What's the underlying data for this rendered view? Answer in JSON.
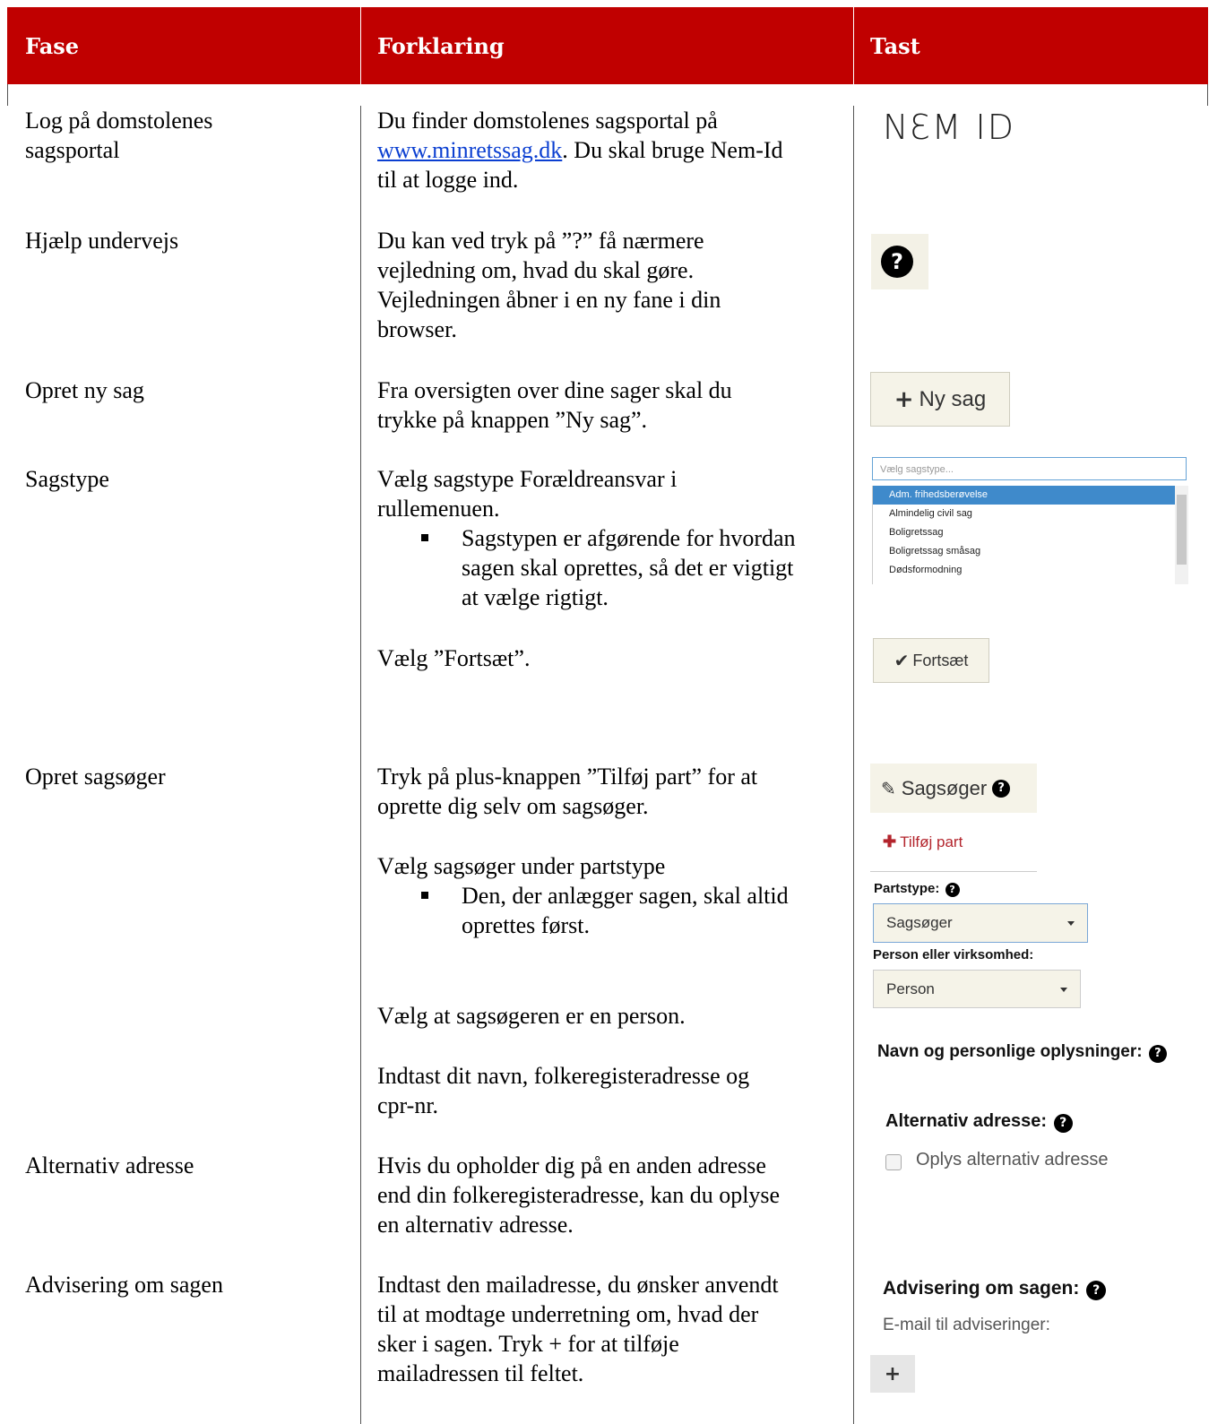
{
  "header": {
    "col1": "Fase",
    "col2": "Forklaring",
    "col3": "Tast"
  },
  "rows": {
    "login": {
      "fase_line1": "Log på domstolenes",
      "fase_line2": "sagsportal",
      "text_line1": "Du finder domstolenes sagsportal på",
      "link": "www.minretssag.dk",
      "text_line2_rest": ". Du skal bruge Nem-Id",
      "text_line3": "til at logge ind.",
      "nemid": "NƐM ID"
    },
    "help": {
      "fase": "Hjælp undervejs",
      "lines": [
        "Du kan ved tryk på ”?” få nærmere",
        "vejledning om, hvad du skal gøre.",
        "Vejledningen åbner i en ny fane i din",
        "browser."
      ],
      "icon": "question-circle-icon"
    },
    "new_case": {
      "fase": "Opret ny sag",
      "lines": [
        "Fra oversigten over dine sager skal du",
        "trykke på knappen ”Ny sag”."
      ],
      "button": "Ny sag"
    },
    "case_type": {
      "fase": "Sagstype",
      "lines": [
        "Vælg sagstype Forældreansvar i",
        "rullemenuen."
      ],
      "bullet_lines": [
        "Sagstypen er afgørende for hvordan",
        "sagen skal oprettes, så det er vigtigt",
        "at vælge rigtigt."
      ],
      "select_placeholder": "Vælg sagstype...",
      "options": [
        "Adm. frihedsberøvelse",
        "Almindelig civil sag",
        "Boligretssag",
        "Boligretssag småsag",
        "Dødsformodning"
      ],
      "continue_text": "Vælg ”Fortsæt”.",
      "continue_button": "Fortsæt"
    },
    "plaintiff": {
      "fase": "Opret sagsøger",
      "lines1": [
        "Tryk på plus-knappen ”Tilføj part” for at",
        "oprette dig selv om sagsøger."
      ],
      "line2": "Vælg sagsøger under partstype",
      "bullet_lines": [
        "Den, der anlægger sagen, skal altid",
        "oprettes først."
      ],
      "line3": "Vælg at sagsøgeren er en person.",
      "lines4": [
        "Indtast dit navn, folkeregisteradresse og",
        "cpr-nr."
      ],
      "panel_title": "Sagsøger",
      "add_party": "Tilføj part",
      "party_type_label": "Partstype:",
      "party_type_value": "Sagsøger",
      "person_label": "Person eller virksomhed:",
      "person_value": "Person",
      "personal_info_title": "Navn og personlige oplysninger:"
    },
    "alt_address": {
      "fase": "Alternativ adresse",
      "lines": [
        "Hvis du opholder dig på en anden adresse",
        "end din folkeregisteradresse, kan du oplyse",
        "en alternativ adresse."
      ],
      "title": "Alternativ adresse:",
      "checkbox_label": "Oplys alternativ adresse"
    },
    "notify": {
      "fase": "Advisering om sagen",
      "lines": [
        "Indtast den mailadresse, du ønsker anvendt",
        "til at modtage underretning om, hvad der",
        "sker i sagen. Tryk + for at tilføje",
        "mailadressen til feltet."
      ],
      "title": "Advisering om sagen:",
      "email_label": "E-mail til adviseringer:",
      "plus": "+"
    }
  },
  "colors": {
    "header_bg": "#c00000",
    "link": "#0b3fd1",
    "select_active": "#3f8acb",
    "add_party": "#b3242c"
  }
}
